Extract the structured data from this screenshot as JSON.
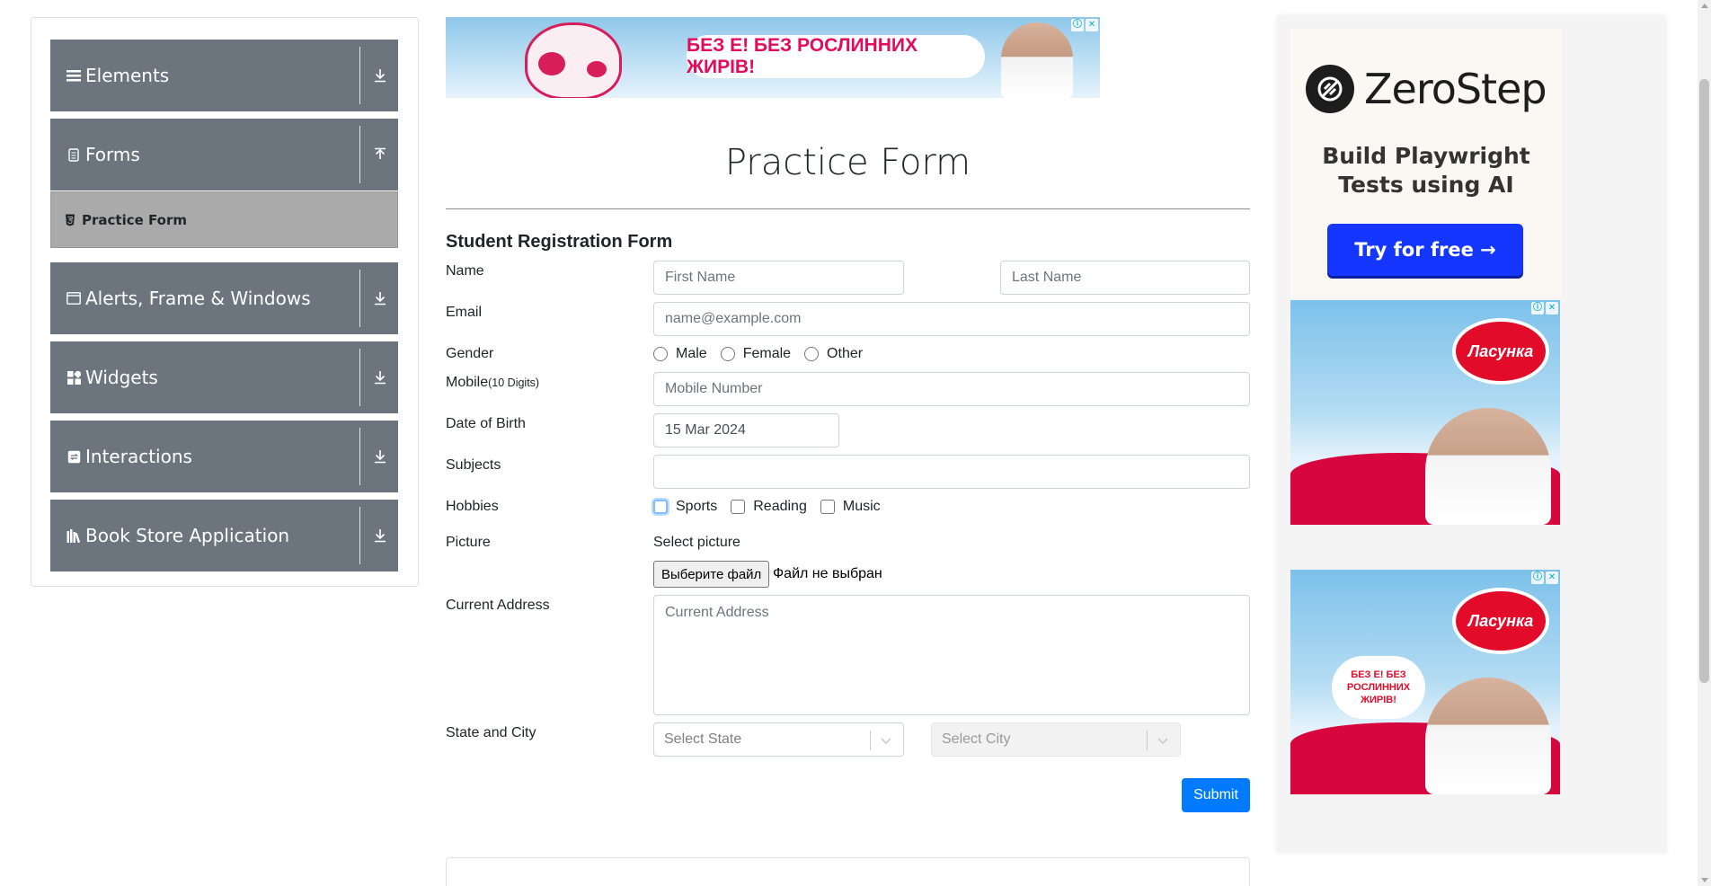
{
  "sidebar": {
    "groups": [
      {
        "label": "Elements",
        "icon": "menu-lines-icon",
        "arrow": "download-arrow-icon"
      },
      {
        "label": "Forms",
        "icon": "document-icon",
        "arrow": "upload-arrow-icon"
      },
      {
        "label": "Alerts, Frame & Windows",
        "icon": "window-icon",
        "arrow": "download-arrow-icon"
      },
      {
        "label": "Widgets",
        "icon": "widgets-grid-icon",
        "arrow": "download-arrow-icon"
      },
      {
        "label": "Interactions",
        "icon": "interaction-icon",
        "arrow": "download-arrow-icon"
      },
      {
        "label": "Book Store Application",
        "icon": "books-icon",
        "arrow": "download-arrow-icon"
      }
    ],
    "active_item": {
      "label": "Practice Form",
      "icon": "html5-icon"
    }
  },
  "ads": {
    "banner_text": "БЕЗ Е! БЕЗ РОСЛИННИХ ЖИРІВ!",
    "zerostep_name": "ZeroStep",
    "zerostep_tagline_1": "Build Playwright",
    "zerostep_tagline_2": "Tests using AI",
    "zerostep_cta": "Try for free →",
    "lasunka_logo": "Ласунка",
    "lasunka_bubble": "БЕЗ Е! БЕЗ РОСЛИННИХ ЖИРІВ!",
    "badge_info": "ⓘ",
    "badge_close": "✕"
  },
  "page": {
    "title": "Practice Form",
    "form_heading": "Student Registration Form"
  },
  "form": {
    "name_label": "Name",
    "first_name_placeholder": "First Name",
    "last_name_placeholder": "Last Name",
    "email_label": "Email",
    "email_placeholder": "name@example.com",
    "gender_label": "Gender",
    "gender_options": [
      "Male",
      "Female",
      "Other"
    ],
    "mobile_label": "Mobile",
    "mobile_hint": "(10 Digits)",
    "mobile_placeholder": "Mobile Number",
    "dob_label": "Date of Birth",
    "dob_value": "15 Mar 2024",
    "subjects_label": "Subjects",
    "subjects_value": "",
    "hobbies_label": "Hobbies",
    "hobbies_options": [
      "Sports",
      "Reading",
      "Music"
    ],
    "picture_label": "Picture",
    "picture_select_label": "Select picture",
    "file_button": "Выберите файл",
    "file_status": "Файл не выбран",
    "address_label": "Current Address",
    "address_placeholder": "Current Address",
    "state_city_label": "State and City",
    "state_placeholder": "Select State",
    "city_placeholder": "Select City",
    "submit_label": "Submit"
  },
  "colors": {
    "sidebar_bg": "#6c757d",
    "active_item_bg": "#aaaaaa",
    "submit_bg": "#007bff",
    "zerostep_cta_bg": "#1436ff",
    "lasunka_red": "#e30b2a"
  }
}
